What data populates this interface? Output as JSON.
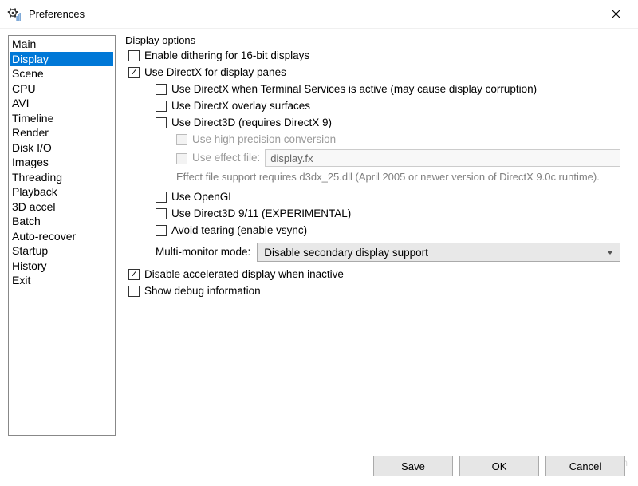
{
  "window": {
    "title": "Preferences"
  },
  "sidebar": {
    "items": [
      {
        "label": "Main"
      },
      {
        "label": "Display"
      },
      {
        "label": "Scene"
      },
      {
        "label": "CPU"
      },
      {
        "label": "AVI"
      },
      {
        "label": "Timeline"
      },
      {
        "label": "Render"
      },
      {
        "label": "Disk I/O"
      },
      {
        "label": "Images"
      },
      {
        "label": "Threading"
      },
      {
        "label": "Playback"
      },
      {
        "label": "3D accel"
      },
      {
        "label": "Batch"
      },
      {
        "label": "Auto-recover"
      },
      {
        "label": "Startup"
      },
      {
        "label": "History"
      },
      {
        "label": "Exit"
      }
    ],
    "selected_index": 1
  },
  "panel": {
    "group_title": "Display options",
    "cb_dithering": "Enable dithering for 16-bit displays",
    "cb_directx": "Use DirectX for display panes",
    "cb_directx_ts": "Use DirectX when Terminal Services is active (may cause display corruption)",
    "cb_overlay": "Use DirectX overlay surfaces",
    "cb_d3d": "Use Direct3D (requires DirectX 9)",
    "cb_highprecision": "Use high precision conversion",
    "cb_effectfile": "Use effect file:",
    "effectfile_value": "display.fx",
    "effect_note": "Effect file support requires d3dx_25.dll (April 2005 or newer version of DirectX 9.0c runtime).",
    "cb_opengl": "Use OpenGL",
    "cb_d3d911": "Use Direct3D 9/11 (EXPERIMENTAL)",
    "cb_vsync": "Avoid tearing (enable vsync)",
    "mm_label": "Multi-monitor mode:",
    "mm_value": "Disable secondary display support",
    "cb_disable_accel": "Disable accelerated display when inactive",
    "cb_debug": "Show debug information"
  },
  "buttons": {
    "save": "Save",
    "ok": "OK",
    "cancel": "Cancel"
  },
  "watermark": "LO4D.com"
}
